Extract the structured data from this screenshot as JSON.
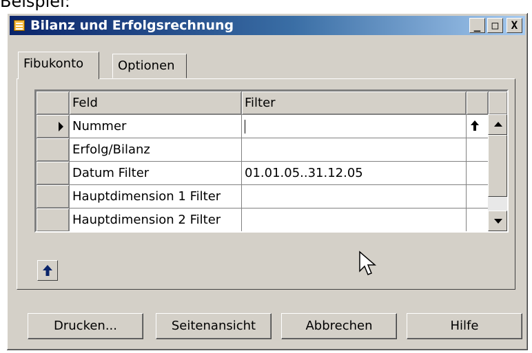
{
  "above_text": "Beispiel:",
  "window": {
    "title": "Bilanz und Erfolgsrechnung",
    "controls": {
      "minimize": "_",
      "maximize": "□",
      "close": "X"
    }
  },
  "tabs": [
    {
      "label": "Fibukonto",
      "active": true
    },
    {
      "label": "Optionen",
      "active": false
    }
  ],
  "grid": {
    "columns": [
      "Feld",
      "Filter"
    ],
    "rows": [
      {
        "field": "Nummer",
        "filter": "",
        "current": true
      },
      {
        "field": "Erfolg/Bilanz",
        "filter": ""
      },
      {
        "field": "Datum Filter",
        "filter": "01.01.05..31.12.05"
      },
      {
        "field": "Hauptdimension 1 Filter",
        "filter": ""
      },
      {
        "field": "Hauptdimension 2 Filter",
        "filter": ""
      }
    ]
  },
  "buttons": {
    "print": "Drucken...",
    "preview": "Seitenansicht",
    "cancel": "Abbrechen",
    "help": "Hilfe"
  },
  "colors": {
    "titlebar_start": "#0a246a",
    "titlebar_end": "#a6caf0",
    "face": "#d4d0c8",
    "arrow_blue": "#0a246a"
  }
}
